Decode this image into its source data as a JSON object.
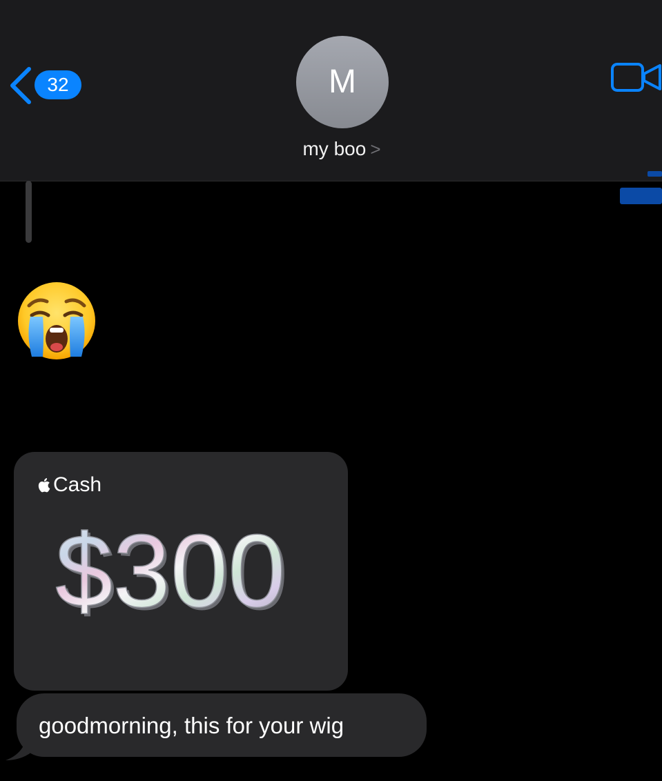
{
  "header": {
    "back_count": "32",
    "avatar_initial": "M",
    "contact_name": "my boo",
    "name_chevron": ">",
    "accent_color": "#0a84ff"
  },
  "messages": [
    {
      "type": "emoji",
      "icon": "loudly-crying-face-icon",
      "direction": "received"
    },
    {
      "type": "apple-cash",
      "direction": "received",
      "brand_label": "Cash",
      "amount": "$300"
    },
    {
      "type": "text",
      "direction": "received",
      "text": "goodmorning, this for your wig"
    }
  ],
  "colors": {
    "background": "#000000",
    "header_background": "#1b1b1d",
    "bubble_background": "#29292b"
  }
}
